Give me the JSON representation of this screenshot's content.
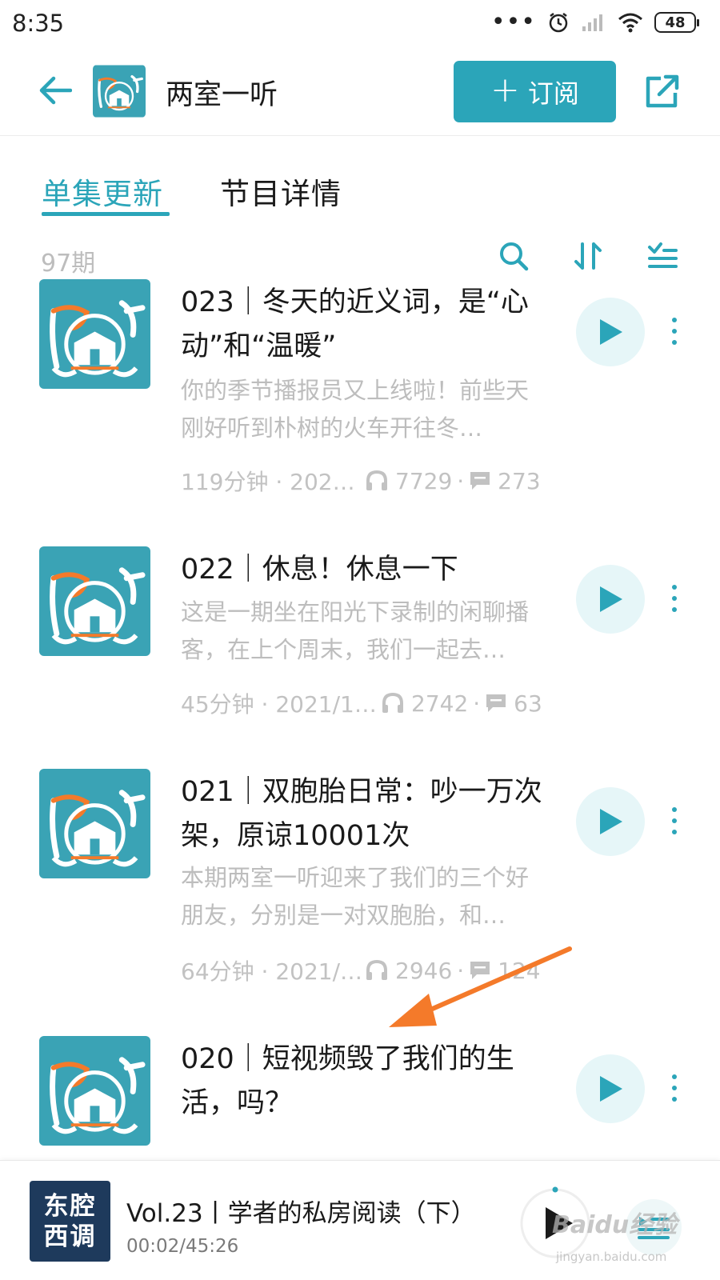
{
  "status_bar": {
    "time": "8:35",
    "battery": "48"
  },
  "header": {
    "title": "两室一听",
    "subscribe_label": "订阅"
  },
  "tabs": [
    {
      "label": "单集更新"
    },
    {
      "label": "节目详情"
    }
  ],
  "toolbar": {
    "episode_count": "97期"
  },
  "episodes": [
    {
      "title": "023｜冬天的近义词，是“心动”和“温暖”",
      "desc": "你的季节播报员又上线啦！前些天刚好听到朴树的火车开往冬…",
      "duration": "119分钟 · 2021…",
      "plays": "7729",
      "comments": "273"
    },
    {
      "title": "022｜休息！休息一下",
      "desc": "这是一期坐在阳光下录制的闲聊播客，在上个周末，我们一起去…",
      "duration": "45分钟 · 2021/1…",
      "plays": "2742",
      "comments": "63"
    },
    {
      "title": "021｜双胞胎日常：吵一万次架，原谅10001次",
      "desc": "本期两室一听迎来了我们的三个好朋友，分别是一对双胞胎，和…",
      "duration": "64分钟 · 2021/…",
      "plays": "2946",
      "comments": "124"
    },
    {
      "title": "020｜短视频毁了我们的生活，吗？",
      "desc": "",
      "duration": "",
      "plays": "",
      "comments": ""
    }
  ],
  "mini_player": {
    "cover_line1": "东腔",
    "cover_line2": "西调",
    "title": "Vol.23丨学者的私房阅读（下）",
    "time": "00:02/45:26"
  },
  "watermark": {
    "brand": "Baidu经验",
    "url": "jingyan.baidu.com"
  },
  "colors": {
    "accent": "#2ba5b9",
    "annotation": "#f47a2a",
    "cover_bg": "#3aa3b5"
  }
}
